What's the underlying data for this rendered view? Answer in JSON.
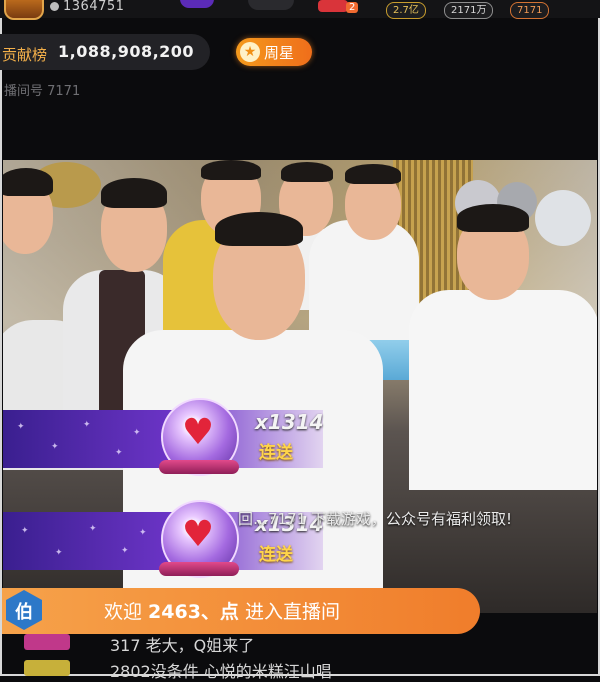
{
  "header": {
    "viewer_count": "1364751",
    "badges": [
      "2.7亿",
      "2171万",
      "7171"
    ]
  },
  "contribution": {
    "label": "贡献榜",
    "value": "1,088,908,200",
    "week_star_label": "周星",
    "room_id": "播间号 7171"
  },
  "gift_combos": [
    {
      "multiplier": "x1314",
      "label": "连送"
    },
    {
      "multiplier": "x1314",
      "label": "连送"
    }
  ],
  "notice": {
    "text": "回…7171 下载游戏，公众号有福利领取!"
  },
  "welcome": {
    "badge_char": "伯",
    "prefix": "欢迎 ",
    "name": "2463、点",
    "suffix": " 进入直播间"
  },
  "chat": [
    {
      "text": "317 老大，Q姐来了"
    },
    {
      "text": "2802没条件 心悦的米糕汪山唱"
    }
  ]
}
